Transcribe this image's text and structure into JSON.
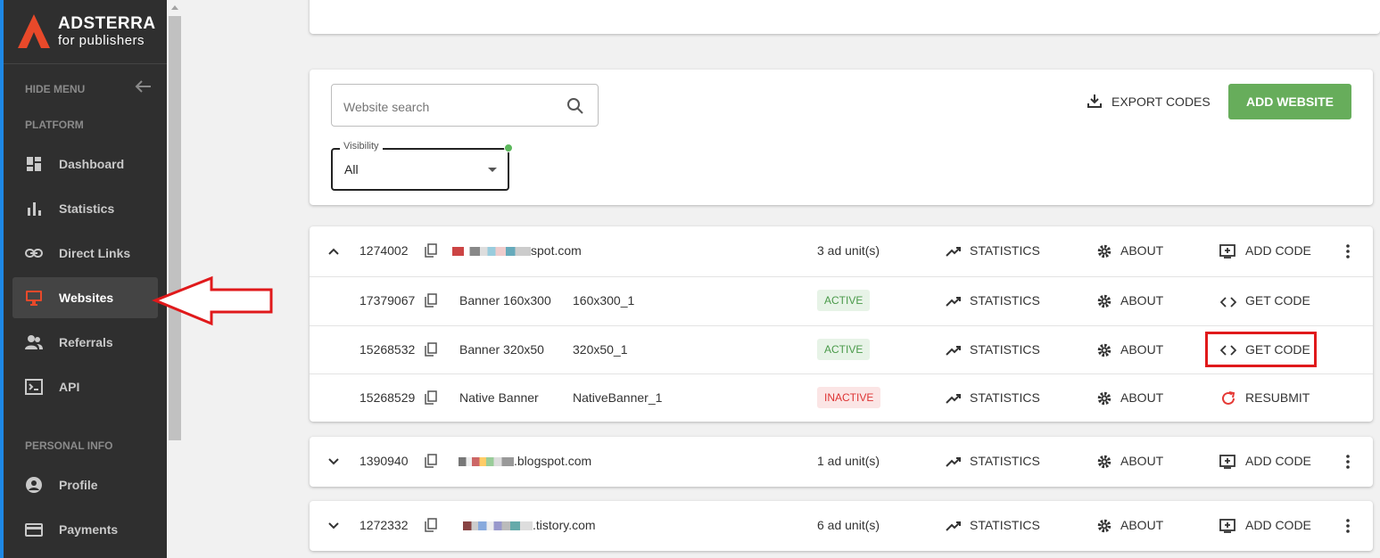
{
  "brand": {
    "name": "ADSTERRA",
    "sub": "for publishers"
  },
  "sidebar": {
    "hide_menu": "HIDE MENU",
    "section_platform": "PLATFORM",
    "section_personal": "PERSONAL INFO",
    "items": [
      {
        "label": "Dashboard",
        "icon": "dashboard-icon"
      },
      {
        "label": "Statistics",
        "icon": "bar-chart-icon"
      },
      {
        "label": "Direct Links",
        "icon": "link-icon"
      },
      {
        "label": "Websites",
        "icon": "monitor-icon",
        "active": true
      },
      {
        "label": "Referrals",
        "icon": "people-icon"
      },
      {
        "label": "API",
        "icon": "terminal-icon"
      },
      {
        "label": "Profile",
        "icon": "account-circle-icon"
      },
      {
        "label": "Payments",
        "icon": "credit-card-icon"
      }
    ]
  },
  "toolbar": {
    "search_placeholder": "Website search",
    "visibility_label": "Visibility",
    "visibility_value": "All",
    "export_label": "EXPORT CODES",
    "add_website_label": "ADD WEBSITE"
  },
  "actions": {
    "statistics": "STATISTICS",
    "about": "ABOUT",
    "add_code": "ADD CODE",
    "get_code": "GET CODE",
    "resubmit": "RESUBMIT"
  },
  "websites": [
    {
      "id": "1274002",
      "domain": "spot.com",
      "units": "3 ad unit(s)",
      "expanded": true,
      "ad_units": [
        {
          "id": "17379067",
          "type": "Banner 160x300",
          "name": "160x300_1",
          "status": "ACTIVE",
          "action": "GET CODE"
        },
        {
          "id": "15268532",
          "type": "Banner 320x50",
          "name": "320x50_1",
          "status": "ACTIVE",
          "action": "GET CODE"
        },
        {
          "id": "15268529",
          "type": "Native Banner",
          "name": "NativeBanner_1",
          "status": "INACTIVE",
          "action": "RESUBMIT"
        }
      ]
    },
    {
      "id": "1390940",
      "domain": ".blogspot.com",
      "units": "1 ad unit(s)",
      "expanded": false
    },
    {
      "id": "1272332",
      "domain": ".tistory.com",
      "units": "6 ad unit(s)",
      "expanded": false
    }
  ],
  "colors": {
    "sidebar_bg": "#2f2f2f",
    "accent_green": "#67ad5b",
    "annotation_red": "#e0191b",
    "active_green": "#4a9a4a",
    "inactive_red": "#dd3333"
  }
}
